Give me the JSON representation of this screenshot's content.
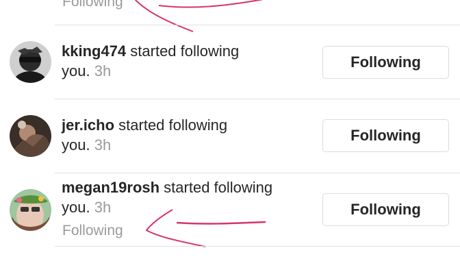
{
  "top": {
    "status": "Following"
  },
  "notifications": [
    {
      "username": "kking474",
      "action": " started following",
      "line2": "you.",
      "time": "3h",
      "button": "Following"
    },
    {
      "username": "jer.icho",
      "action": " started following",
      "line2": "you.",
      "time": "3h",
      "button": "Following"
    },
    {
      "username": "megan19rosh",
      "action": " started following",
      "line2": "you.",
      "time": "3h",
      "button": "Following",
      "status": "Following"
    }
  ],
  "colors": {
    "text": "#262626",
    "muted": "#9a9a9a",
    "divider": "#e0e0e0",
    "annotation": "#d6336c"
  }
}
